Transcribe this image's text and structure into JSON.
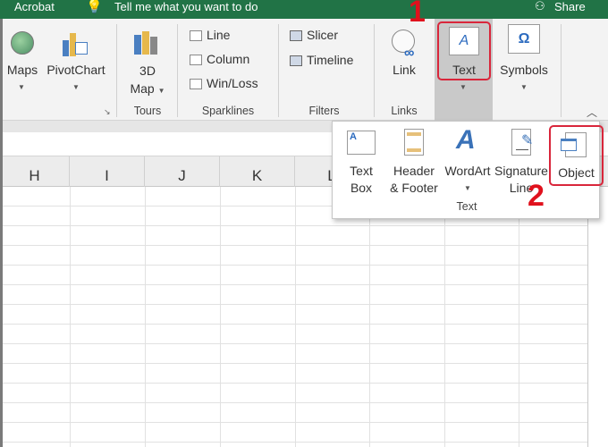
{
  "topbar": {
    "acrobat": "Acrobat",
    "tell_me": "Tell me what you want to do",
    "share": "Share"
  },
  "ribbon": {
    "maps": "Maps",
    "pivotchart": "PivotChart",
    "map3d_1": "3D",
    "map3d_2": "Map",
    "tours": "Tours",
    "line": "Line",
    "column": "Column",
    "winloss": "Win/Loss",
    "sparklines": "Sparklines",
    "slicer": "Slicer",
    "timeline": "Timeline",
    "filters": "Filters",
    "link": "Link",
    "links": "Links",
    "text": "Text",
    "symbols": "Symbols"
  },
  "columns": [
    "H",
    "I",
    "J",
    "K",
    "L"
  ],
  "text_menu": {
    "textbox_1": "Text",
    "textbox_2": "Box",
    "header_1": "Header",
    "header_2": "& Footer",
    "wordart": "WordArt",
    "signature_1": "Signature",
    "signature_2": "Line",
    "object": "Object",
    "group": "Text"
  },
  "annotations": {
    "step1": "1",
    "step2": "2"
  },
  "colors": {
    "title_bar": "#217346",
    "highlight": "#d9263b",
    "annotation": "#e0111d"
  }
}
